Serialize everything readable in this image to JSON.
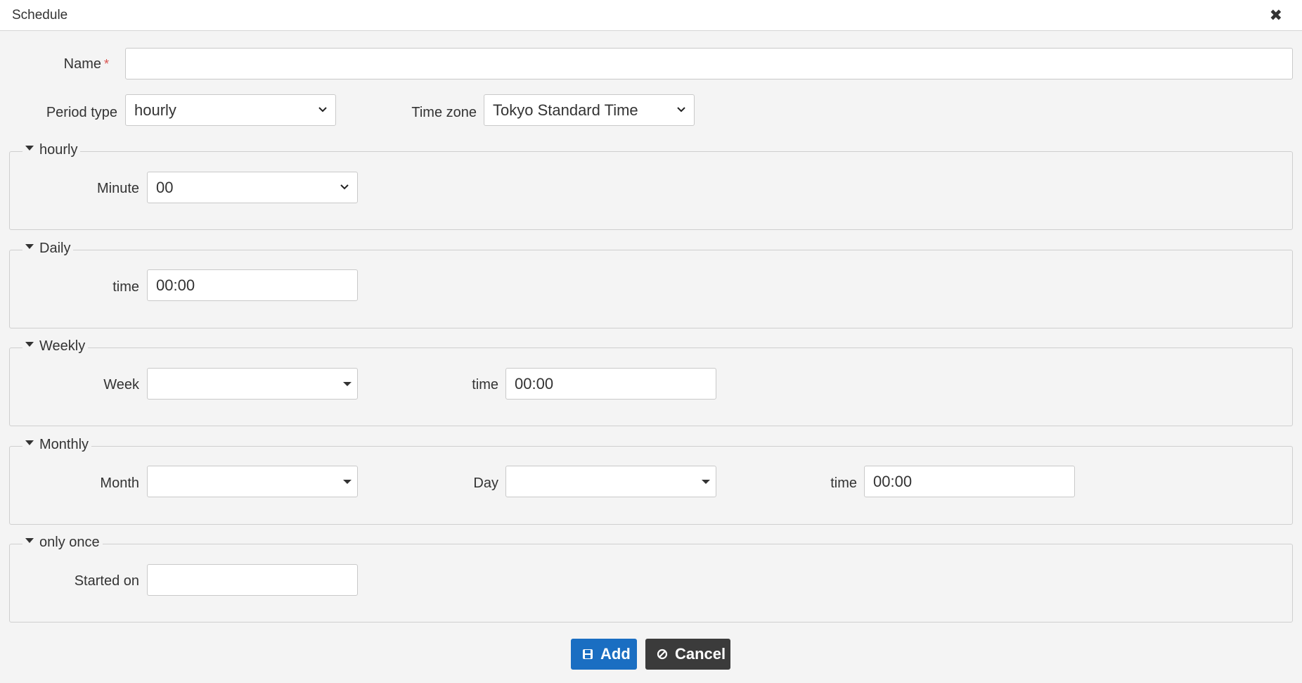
{
  "dialog": {
    "title": "Schedule",
    "close_icon": "close-icon"
  },
  "form": {
    "name_label": "Name",
    "name_required_mark": "*",
    "name_value": "",
    "period_type_label": "Period type",
    "period_type_value": "hourly",
    "time_zone_label": "Time zone",
    "time_zone_value": "Tokyo Standard Time"
  },
  "sections": {
    "hourly": {
      "legend": "hourly",
      "minute_label": "Minute",
      "minute_value": "00"
    },
    "daily": {
      "legend": "Daily",
      "time_label": "time",
      "time_value": "00:00"
    },
    "weekly": {
      "legend": "Weekly",
      "week_label": "Week",
      "week_value": "",
      "time_label": "time",
      "time_value": "00:00"
    },
    "monthly": {
      "legend": "Monthly",
      "month_label": "Month",
      "month_value": "",
      "day_label": "Day",
      "day_value": "",
      "time_label": "time",
      "time_value": "00:00"
    },
    "once": {
      "legend": "only once",
      "started_on_label": "Started on",
      "started_on_value": ""
    }
  },
  "buttons": {
    "add_label": "Add",
    "cancel_label": "Cancel"
  },
  "colors": {
    "add_bg": "#1a6ec2",
    "cancel_bg": "#3b3b3b",
    "required": "#d9534f"
  }
}
